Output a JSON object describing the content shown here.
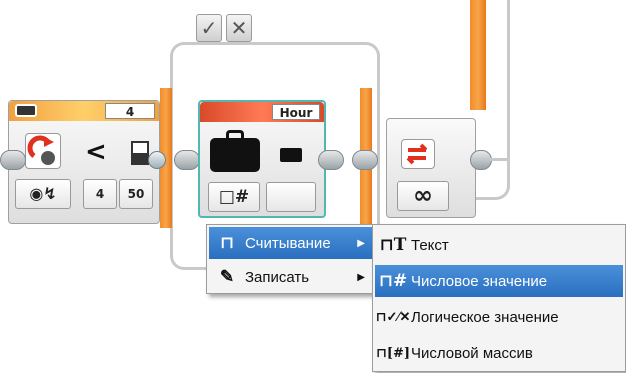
{
  "switch": {
    "check_tab": "✓",
    "x_tab": "✕"
  },
  "wait_block": {
    "header_value": "4",
    "compare_symbol": "<",
    "input_a": "4",
    "input_b": "50",
    "icon": "rotation-sensor-icon",
    "mode_icon": "sensor-mode-icon"
  },
  "file_block": {
    "header_value": "Hour",
    "mode_button": "□#",
    "icon": "briefcase-icon"
  },
  "loop_block": {
    "loop_icon": "loop-arrows-icon",
    "count_label": "∞"
  },
  "menu": {
    "items": [
      {
        "icon": "book-icon",
        "glyph": "⊓",
        "label": "Считывание",
        "selected": true,
        "has_submenu": true
      },
      {
        "icon": "pencil-icon",
        "glyph": "✎",
        "label": "Записать",
        "selected": false,
        "has_submenu": true
      }
    ]
  },
  "submenu": {
    "items": [
      {
        "icon": "text-type-icon",
        "glyph": "T",
        "label": "Текст",
        "selected": false
      },
      {
        "icon": "numeric-type-icon",
        "glyph": "#",
        "label": "Числовое значение",
        "selected": true
      },
      {
        "icon": "logic-type-icon",
        "glyph": "✓⁄✕",
        "label": "Логическое значение",
        "selected": false
      },
      {
        "icon": "numeric-array-icon",
        "glyph": "[#]",
        "label": "Числовой массив",
        "selected": false
      }
    ]
  },
  "colors": {
    "orange": "#f28c28",
    "teal_border": "#4fb8b0",
    "selection": "#2a6fc0",
    "red_header": "#d94a2a"
  }
}
